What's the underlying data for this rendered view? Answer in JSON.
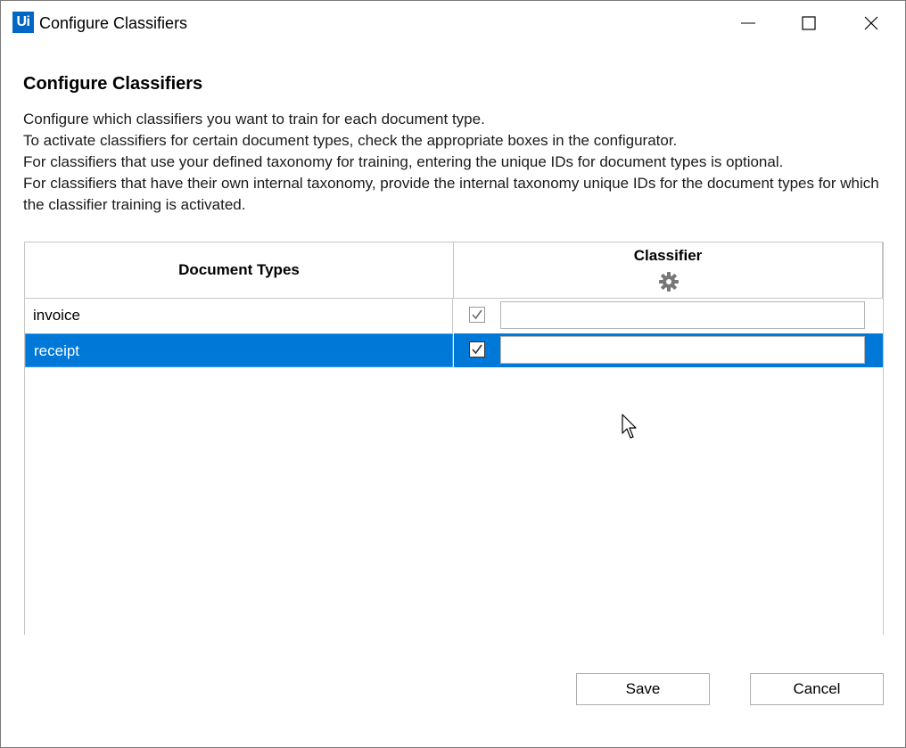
{
  "window": {
    "app_icon_text": "Ui",
    "title": "Configure Classifiers",
    "controls": [
      "minimize-icon",
      "maximize-icon",
      "close-icon"
    ]
  },
  "heading": "Configure Classifiers",
  "description": [
    "Configure which classifiers you want to train for each document type.",
    "To activate classifiers for certain document types, check the appropriate boxes in the configurator.",
    "For classifiers that use your defined taxonomy for training, entering the unique IDs for document types is optional.",
    "For classifiers that have their own internal taxonomy, provide the internal taxonomy unique IDs for the document types for which the classifier training is activated."
  ],
  "grid": {
    "col_document_types": "Document Types",
    "col_classifier": "Classifier",
    "classifier_icon": "gear-icon",
    "rows": [
      {
        "name": "invoice",
        "checked": true,
        "unique_id": "",
        "selected": false
      },
      {
        "name": "receipt",
        "checked": true,
        "unique_id": "",
        "selected": true
      }
    ]
  },
  "buttons": {
    "save": "Save",
    "cancel": "Cancel"
  },
  "colors": {
    "accent": "#0078d7",
    "app_icon": "#0067c5",
    "border": "#c6c6c6"
  }
}
